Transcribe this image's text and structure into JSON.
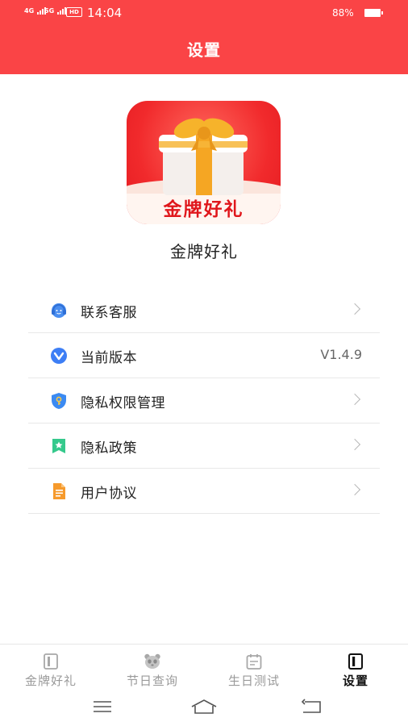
{
  "status_bar": {
    "signal1": "4G",
    "signal2": "5G",
    "hd": "HD",
    "time": "14:04",
    "battery_percent": "88%"
  },
  "header": {
    "title": "设置"
  },
  "app": {
    "logo_text": "金牌好礼",
    "name": "金牌好礼"
  },
  "menu": {
    "items": [
      {
        "label": "联系客服",
        "icon": "headset-icon"
      },
      {
        "label": "当前版本",
        "icon": "version-icon",
        "value": "V1.4.9"
      },
      {
        "label": "隐私权限管理",
        "icon": "shield-key-icon"
      },
      {
        "label": "隐私政策",
        "icon": "bookmark-star-icon"
      },
      {
        "label": "用户协议",
        "icon": "document-icon"
      }
    ]
  },
  "tabbar": {
    "tabs": [
      {
        "label": "金牌好礼",
        "icon": "book-icon",
        "active": false
      },
      {
        "label": "节日查询",
        "icon": "panda-icon",
        "active": false
      },
      {
        "label": "生日测试",
        "icon": "calendar-icon",
        "active": false
      },
      {
        "label": "设置",
        "icon": "book-icon",
        "active": true
      }
    ]
  },
  "navbar": {
    "icons": [
      "menu-icon",
      "home-icon",
      "back-icon"
    ]
  },
  "colors": {
    "accent": "#fa4446",
    "text": "#222222",
    "muted": "#9a9a9a"
  }
}
